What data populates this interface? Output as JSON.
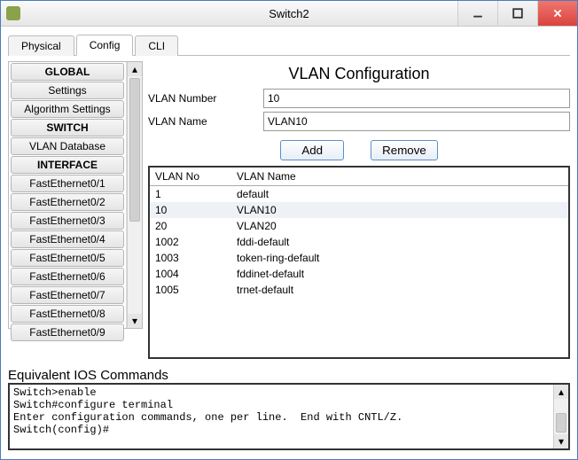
{
  "window": {
    "title": "Switch2"
  },
  "tabs": {
    "physical": "Physical",
    "config": "Config",
    "cli": "CLI"
  },
  "sidebar": {
    "global_header": "GLOBAL",
    "settings": "Settings",
    "algorithm_settings": "Algorithm Settings",
    "switch_header": "SWITCH",
    "vlan_database": "VLAN Database",
    "interface_header": "INTERFACE",
    "ifaces": [
      "FastEthernet0/1",
      "FastEthernet0/2",
      "FastEthernet0/3",
      "FastEthernet0/4",
      "FastEthernet0/5",
      "FastEthernet0/6",
      "FastEthernet0/7",
      "FastEthernet0/8",
      "FastEthernet0/9"
    ]
  },
  "vlan": {
    "heading": "VLAN Configuration",
    "number_label": "VLAN Number",
    "number_value": "10",
    "name_label": "VLAN Name",
    "name_value": "VLAN10",
    "add_label": "Add",
    "remove_label": "Remove",
    "col_no": "VLAN No",
    "col_name": "VLAN Name",
    "rows": [
      {
        "no": "1",
        "name": "default"
      },
      {
        "no": "10",
        "name": "VLAN10"
      },
      {
        "no": "20",
        "name": "VLAN20"
      },
      {
        "no": "1002",
        "name": "fddi-default"
      },
      {
        "no": "1003",
        "name": "token-ring-default"
      },
      {
        "no": "1004",
        "name": "fddinet-default"
      },
      {
        "no": "1005",
        "name": "trnet-default"
      }
    ],
    "selected_index": 1
  },
  "ios": {
    "label": "Equivalent IOS Commands",
    "text": "Switch>enable\nSwitch#configure terminal\nEnter configuration commands, one per line.  End with CNTL/Z.\nSwitch(config)#"
  }
}
